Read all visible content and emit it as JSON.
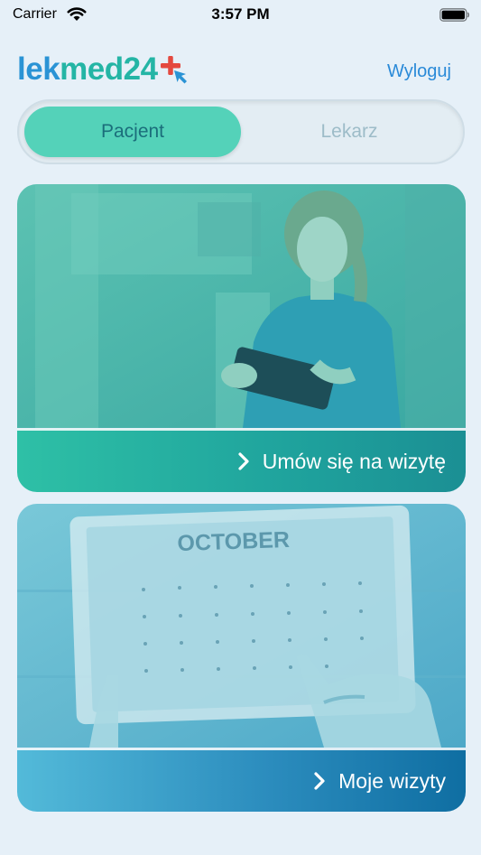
{
  "status_bar": {
    "carrier": "Carrier",
    "time": "3:57 PM"
  },
  "header": {
    "logo_part1": "lek",
    "logo_part2": "med24",
    "logout_label": "Wyloguj"
  },
  "segmented": {
    "options": [
      {
        "label": "Pacjent",
        "selected": true
      },
      {
        "label": "Lekarz",
        "selected": false
      }
    ]
  },
  "cards": [
    {
      "label": "Umów się na wizytę",
      "icon": "chevron-right-icon",
      "image": "nurse-with-tablet-photo"
    },
    {
      "label": "Moje wizyty",
      "icon": "chevron-right-icon",
      "image": "calendar-tablet-photo",
      "calendar_month": "OCTOBER"
    }
  ],
  "colors": {
    "background": "#e6f0f8",
    "accent_teal": "#54d2b9",
    "link_blue": "#2a8ad8",
    "card1_bar": "#1fa39d",
    "card2_bar": "#2c8dbe"
  }
}
